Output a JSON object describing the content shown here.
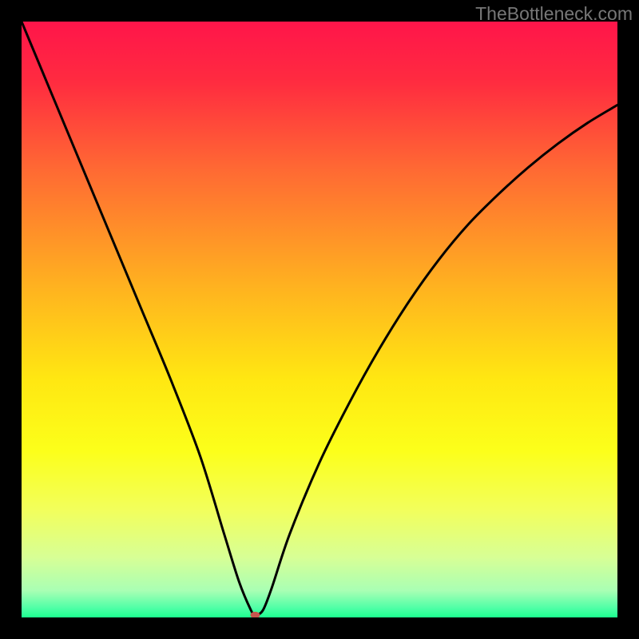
{
  "watermark": "TheBottleneck.com",
  "chart_data": {
    "type": "line",
    "title": "",
    "xlabel": "",
    "ylabel": "",
    "xlim": [
      0,
      100
    ],
    "ylim": [
      0,
      100
    ],
    "background": {
      "type": "vertical-gradient",
      "stops": [
        {
          "pos": 0.0,
          "color": "#ff154a"
        },
        {
          "pos": 0.1,
          "color": "#ff2b40"
        },
        {
          "pos": 0.25,
          "color": "#ff6a33"
        },
        {
          "pos": 0.45,
          "color": "#ffb41f"
        },
        {
          "pos": 0.6,
          "color": "#ffe712"
        },
        {
          "pos": 0.72,
          "color": "#fcff1a"
        },
        {
          "pos": 0.82,
          "color": "#f2ff5c"
        },
        {
          "pos": 0.9,
          "color": "#d7ff96"
        },
        {
          "pos": 0.955,
          "color": "#a9ffb4"
        },
        {
          "pos": 0.985,
          "color": "#4cffa6"
        },
        {
          "pos": 1.0,
          "color": "#1cff8e"
        }
      ]
    },
    "series": [
      {
        "name": "bottleneck-curve",
        "x": [
          0,
          5,
          10,
          15,
          20,
          25,
          30,
          34,
          36.5,
          38.5,
          39.2,
          40.5,
          42,
          45,
          50,
          55,
          60,
          65,
          70,
          75,
          80,
          85,
          90,
          95,
          100
        ],
        "y": [
          100,
          88,
          76,
          64,
          52,
          40,
          27,
          14,
          6,
          1.2,
          0.4,
          1.2,
          5,
          14,
          26,
          36,
          45,
          53,
          60,
          66,
          71,
          75.5,
          79.5,
          83,
          86
        ],
        "stroke": "#000000",
        "stroke_width": 3
      }
    ],
    "marker": {
      "name": "bottleneck-point",
      "x": 39.2,
      "y": 0.4,
      "rx": 0.8,
      "ry": 0.55,
      "fill": "#c6564e"
    }
  }
}
